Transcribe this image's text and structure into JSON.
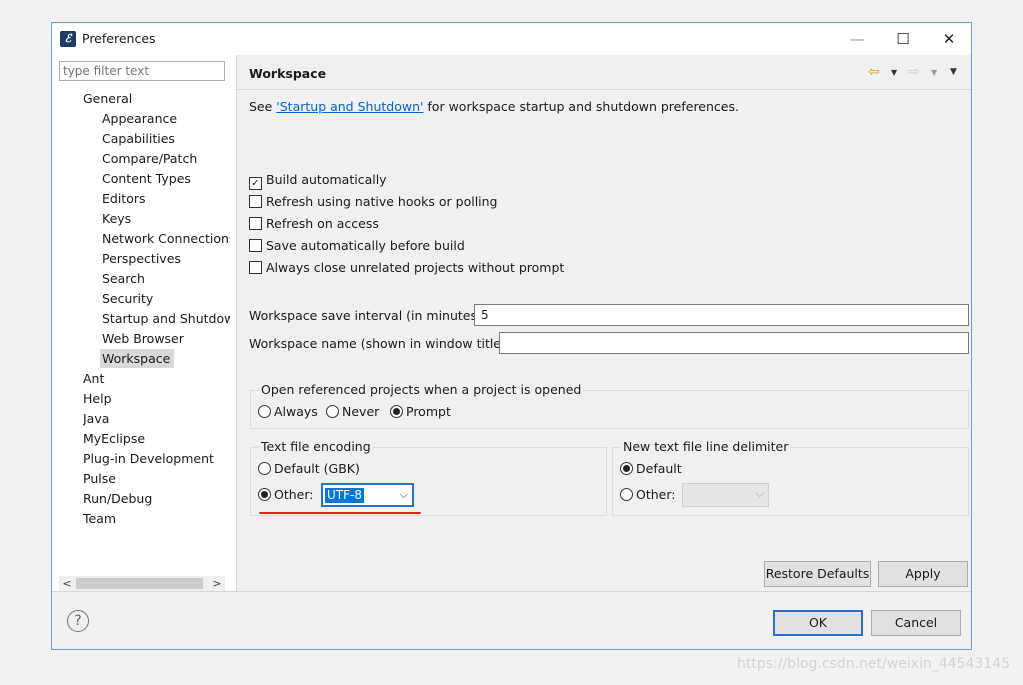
{
  "window": {
    "title": "Preferences",
    "minimize": "—",
    "maximize": "☐",
    "close": "✕"
  },
  "filter": {
    "placeholder": "type filter text"
  },
  "tree": [
    {
      "label": "General",
      "level": 0
    },
    {
      "label": "Appearance",
      "level": 1
    },
    {
      "label": "Capabilities",
      "level": 1
    },
    {
      "label": "Compare/Patch",
      "level": 1
    },
    {
      "label": "Content Types",
      "level": 1
    },
    {
      "label": "Editors",
      "level": 1
    },
    {
      "label": "Keys",
      "level": 1
    },
    {
      "label": "Network Connections",
      "level": 1
    },
    {
      "label": "Perspectives",
      "level": 1
    },
    {
      "label": "Search",
      "level": 1
    },
    {
      "label": "Security",
      "level": 1
    },
    {
      "label": "Startup and Shutdown",
      "level": 1
    },
    {
      "label": "Web Browser",
      "level": 1
    },
    {
      "label": "Workspace",
      "level": 1,
      "selected": true
    },
    {
      "label": "Ant",
      "level": 0
    },
    {
      "label": "Help",
      "level": 0
    },
    {
      "label": "Java",
      "level": 0
    },
    {
      "label": "MyEclipse",
      "level": 0
    },
    {
      "label": "Plug-in Development",
      "level": 0
    },
    {
      "label": "Pulse",
      "level": 0
    },
    {
      "label": "Run/Debug",
      "level": 0
    },
    {
      "label": "Team",
      "level": 0
    }
  ],
  "scroll": {
    "left": "<",
    "right": ">"
  },
  "page": {
    "title": "Workspace",
    "see_prefix": "See ",
    "see_link": "'Startup and Shutdown'",
    "see_suffix": " for workspace startup and shutdown preferences.",
    "checkboxes": [
      {
        "label": "Build automatically",
        "checked": true
      },
      {
        "label": "Refresh using native hooks or polling",
        "checked": false
      },
      {
        "label": "Refresh on access",
        "checked": false
      },
      {
        "label": "Save automatically before build",
        "checked": false
      },
      {
        "label": "Always close unrelated projects without prompt",
        "checked": false
      }
    ],
    "save_interval_label": "Workspace save interval (in minutes):",
    "save_interval_value": "5",
    "workspace_name_label": "Workspace name (shown in window title):",
    "workspace_name_value": "",
    "open_ref": {
      "title": "Open referenced projects when a project is opened",
      "options": [
        "Always",
        "Never",
        "Prompt"
      ],
      "selected": "Prompt"
    },
    "encoding": {
      "title": "Text file encoding",
      "default_label": "Default (GBK)",
      "other_label": "Other:",
      "selected": "Other",
      "other_value": "UTF-8"
    },
    "line_delim": {
      "title": "New text file line delimiter",
      "default_label": "Default",
      "other_label": "Other:",
      "selected": "Default",
      "other_value": ""
    },
    "restore_defaults": "Restore Defaults",
    "apply": "Apply"
  },
  "footer": {
    "help": "?",
    "ok": "OK",
    "cancel": "Cancel"
  },
  "watermark": "https://blog.csdn.net/weixin_44543145",
  "colors": {
    "accent": "#2a6fc9",
    "link": "#0066cc",
    "annotation": "#e0231b"
  }
}
